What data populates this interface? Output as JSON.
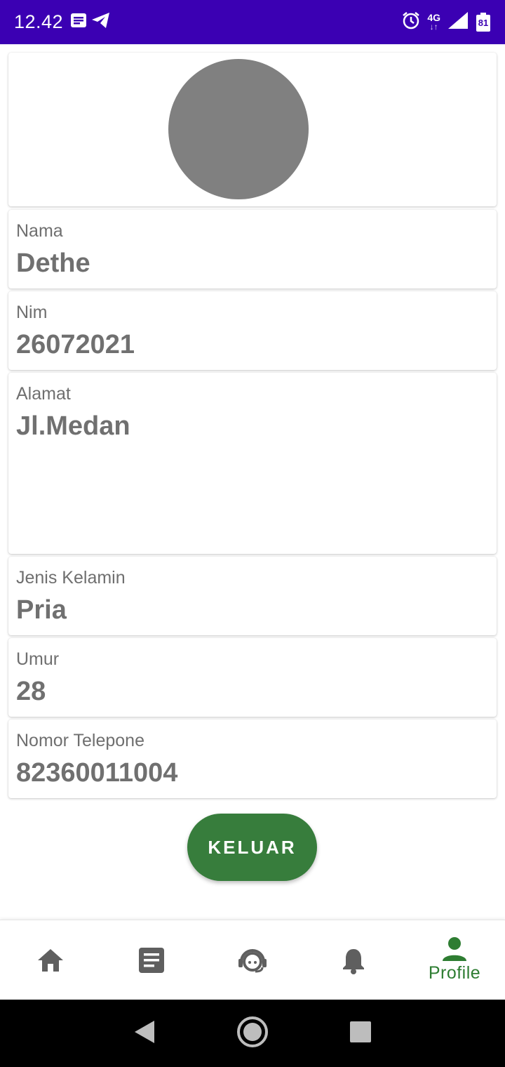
{
  "status_bar": {
    "time": "12.42",
    "network": "4G",
    "battery": "81",
    "icons": [
      "notes-icon",
      "telegram-icon",
      "alarm-icon",
      "signal-icon",
      "battery-icon"
    ]
  },
  "profile": {
    "fields": [
      {
        "label": "Nama",
        "value": "Dethe"
      },
      {
        "label": "Nim",
        "value": "26072021"
      },
      {
        "label": "Alamat",
        "value": "Jl.Medan"
      },
      {
        "label": "Jenis Kelamin",
        "value": "Pria"
      },
      {
        "label": "Umur",
        "value": "28"
      },
      {
        "label": "Nomor Telepone",
        "value": "82360011004"
      }
    ],
    "logout_label": "KELUAR"
  },
  "bottom_nav": {
    "items": [
      {
        "icon": "home-icon"
      },
      {
        "icon": "article-icon"
      },
      {
        "icon": "support-agent-icon"
      },
      {
        "icon": "notifications-icon"
      },
      {
        "icon": "person-icon",
        "label": "Profile",
        "active": true
      }
    ]
  },
  "colors": {
    "status_bar": "#3b00b3",
    "accent_green": "#377d3c",
    "avatar_placeholder": "#808080",
    "text_gray": "#707070"
  }
}
